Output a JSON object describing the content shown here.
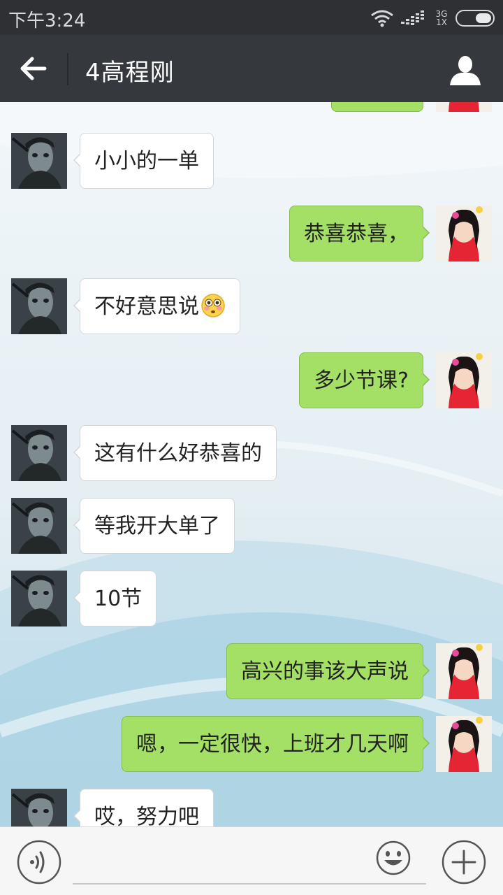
{
  "status_bar": {
    "time": "下午3:24",
    "network_top": "3G",
    "network_bottom": "1X"
  },
  "header": {
    "title": "4高程刚",
    "back_icon": "arrow-left-icon",
    "profile_icon": "person-icon"
  },
  "messages": [
    {
      "side": "out",
      "text": "",
      "partial": true
    },
    {
      "side": "in",
      "text": "小小的一单"
    },
    {
      "side": "out",
      "text": "恭喜恭喜，"
    },
    {
      "side": "in",
      "text": "不好意思说",
      "emoji": "flushed-face-emoji"
    },
    {
      "side": "out",
      "text": "多少节课?"
    },
    {
      "side": "in",
      "text": "这有什么好恭喜的"
    },
    {
      "side": "in",
      "text": "等我开大单了"
    },
    {
      "side": "in",
      "text": "10节"
    },
    {
      "side": "out",
      "text": "高兴的事该大声说"
    },
    {
      "side": "out",
      "text": "嗯，一定很快，上班才几天啊"
    },
    {
      "side": "in",
      "text": "哎，努力吧"
    }
  ],
  "input_bar": {
    "placeholder": "",
    "voice_icon": "voice-icon",
    "emoji_icon": "smiley-icon",
    "more_icon": "plus-icon"
  },
  "colors": {
    "status_bar": "#2e3033",
    "title_bar": "#35393d",
    "outgoing_bubble": "#a4e065",
    "incoming_bubble": "#ffffff"
  }
}
